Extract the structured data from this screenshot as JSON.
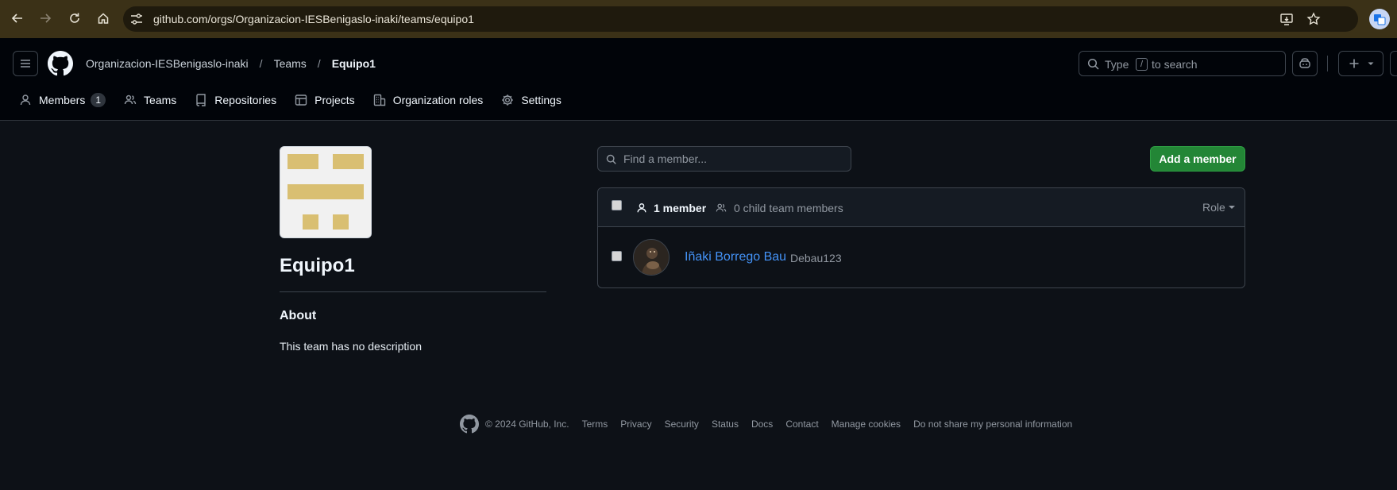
{
  "browser": {
    "url": "github.com/orgs/Organizacion-IESBenigaslo-inaki/teams/equipo1"
  },
  "header": {
    "breadcrumb": {
      "org": "Organizacion-IESBenigaslo-inaki",
      "separator": "/",
      "teams": "Teams",
      "current": "Equipo1"
    },
    "search": {
      "prefix": "Type",
      "key": "/",
      "suffix": "to search"
    }
  },
  "org_nav": {
    "items": [
      {
        "label": "Members",
        "icon": "person-icon",
        "count": "1"
      },
      {
        "label": "Teams",
        "icon": "people-icon"
      },
      {
        "label": "Repositories",
        "icon": "repo-icon"
      },
      {
        "label": "Projects",
        "icon": "table-icon"
      },
      {
        "label": "Organization roles",
        "icon": "organization-icon"
      },
      {
        "label": "Settings",
        "icon": "gear-icon"
      }
    ]
  },
  "team": {
    "name": "Equipo1",
    "about_heading": "About",
    "description": "This team has no description",
    "avatar_color": "#d9bf72"
  },
  "members": {
    "search_placeholder": "Find a member...",
    "add_button": "Add a member",
    "header": {
      "member_count": "1 member",
      "child_count": "0 child team members",
      "role_label": "Role"
    },
    "rows": [
      {
        "name": "Iñaki Borrego Bau",
        "login": "Debau123"
      }
    ]
  },
  "footer": {
    "copyright": "© 2024 GitHub, Inc.",
    "links": [
      "Terms",
      "Privacy",
      "Security",
      "Status",
      "Docs",
      "Contact",
      "Manage cookies",
      "Do not share my personal information"
    ]
  },
  "colors": {
    "background": "#0d1117",
    "header_bg": "#010409",
    "primary_button": "#238636",
    "link": "#4493f8"
  }
}
